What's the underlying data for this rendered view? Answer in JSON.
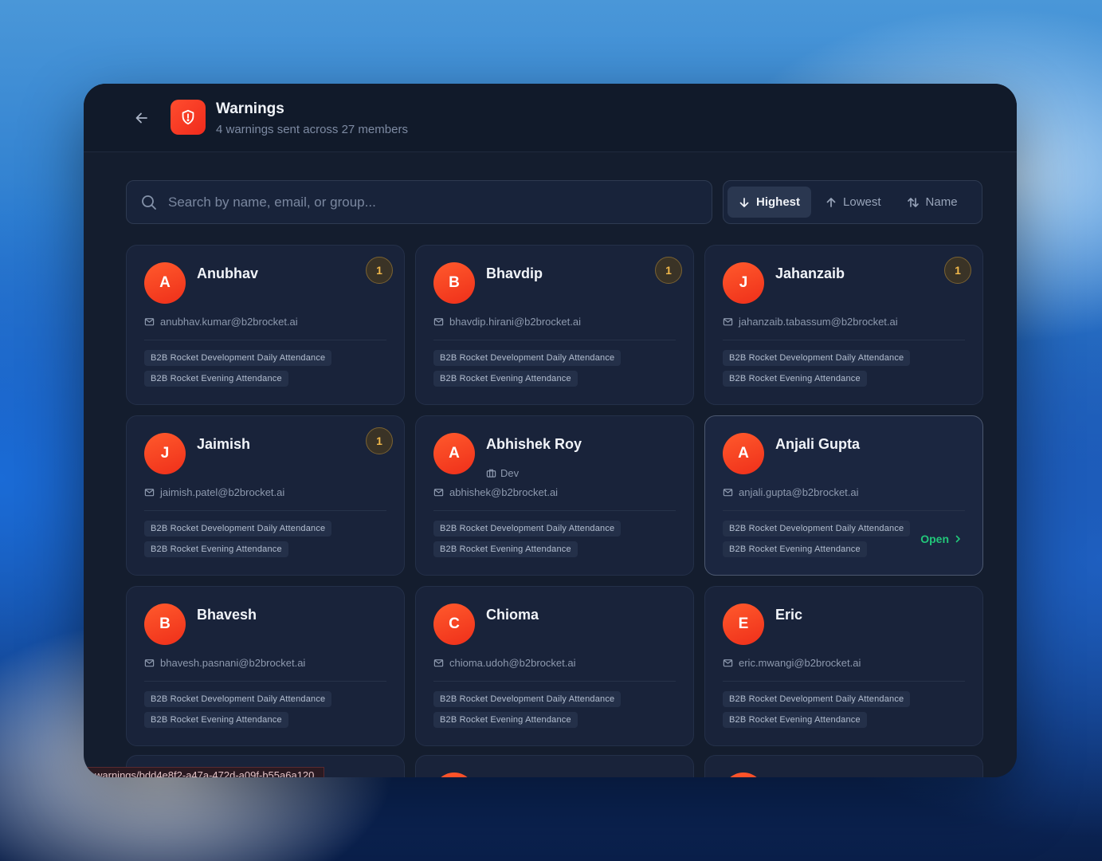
{
  "header": {
    "title": "Warnings",
    "subtitle": "4 warnings sent across 27 members"
  },
  "search": {
    "placeholder": "Search by name, email, or group..."
  },
  "sort": {
    "options": [
      {
        "label": "Highest",
        "icon": "arrow-down-icon",
        "active": true
      },
      {
        "label": "Lowest",
        "icon": "arrow-up-icon",
        "active": false
      },
      {
        "label": "Name",
        "icon": "sort-arrows-icon",
        "active": false
      }
    ]
  },
  "members": [
    {
      "initial": "A",
      "name": "Anubhav",
      "email": "anubhav.kumar@b2brocket.ai",
      "warnings": "1",
      "role": "",
      "groups": [
        "B2B Rocket Development Daily Attendance",
        "B2B Rocket Evening Attendance"
      ]
    },
    {
      "initial": "B",
      "name": "Bhavdip",
      "email": "bhavdip.hirani@b2brocket.ai",
      "warnings": "1",
      "role": "",
      "groups": [
        "B2B Rocket Development Daily Attendance",
        "B2B Rocket Evening Attendance"
      ]
    },
    {
      "initial": "J",
      "name": "Jahanzaib",
      "email": "jahanzaib.tabassum@b2brocket.ai",
      "warnings": "1",
      "role": "",
      "groups": [
        "B2B Rocket Development Daily Attendance",
        "B2B Rocket Evening Attendance"
      ]
    },
    {
      "initial": "J",
      "name": "Jaimish",
      "email": "jaimish.patel@b2brocket.ai",
      "warnings": "1",
      "role": "",
      "groups": [
        "B2B Rocket Development Daily Attendance",
        "B2B Rocket Evening Attendance"
      ]
    },
    {
      "initial": "A",
      "name": "Abhishek Roy",
      "email": "abhishek@b2brocket.ai",
      "warnings": "",
      "role": "Dev",
      "groups": [
        "B2B Rocket Development Daily Attendance",
        "B2B Rocket Evening Attendance"
      ]
    },
    {
      "initial": "A",
      "name": "Anjali Gupta",
      "email": "anjali.gupta@b2brocket.ai",
      "warnings": "",
      "role": "",
      "groups": [
        "B2B Rocket Development Daily Attendance",
        "B2B Rocket Evening Attendance"
      ],
      "open_label": "Open"
    },
    {
      "initial": "B",
      "name": "Bhavesh",
      "email": "bhavesh.pasnani@b2brocket.ai",
      "warnings": "",
      "role": "",
      "groups": [
        "B2B Rocket Development Daily Attendance",
        "B2B Rocket Evening Attendance"
      ]
    },
    {
      "initial": "C",
      "name": "Chioma",
      "email": "chioma.udoh@b2brocket.ai",
      "warnings": "",
      "role": "",
      "groups": [
        "B2B Rocket Development Daily Attendance",
        "B2B Rocket Evening Attendance"
      ]
    },
    {
      "initial": "E",
      "name": "Eric",
      "email": "eric.mwangi@b2brocket.ai",
      "warnings": "",
      "role": "",
      "groups": [
        "B2B Rocket Development Daily Attendance",
        "B2B Rocket Evening Attendance"
      ]
    }
  ],
  "status_url": "warnings/bdd4e8f2-a47a-472d-a09f-b55a6a120",
  "colors": {
    "accent": "#f0391f",
    "success": "#22c77a",
    "warning": "#f2b94a"
  }
}
